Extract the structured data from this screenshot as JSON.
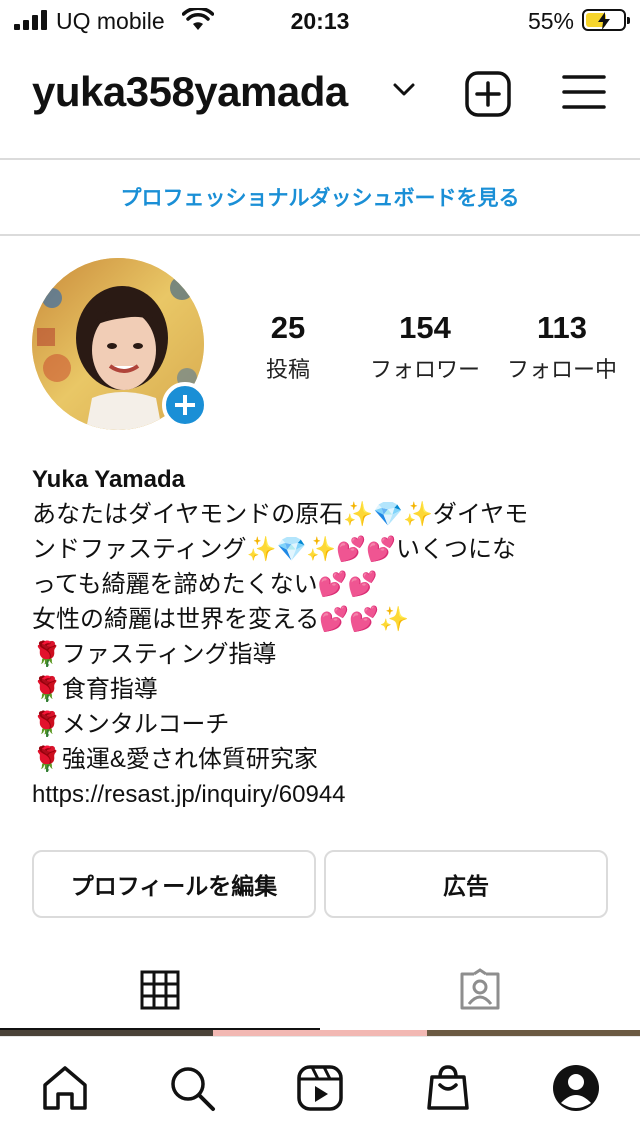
{
  "status_bar": {
    "carrier": "UQ mobile",
    "time": "20:13",
    "battery_percent": "55%",
    "battery_level": 0.55,
    "charging": true
  },
  "header": {
    "username": "yuka358yamada",
    "icons": [
      "chevron-down-icon",
      "new-post-icon",
      "menu-icon"
    ]
  },
  "dashboard": {
    "label": "プロフェッショナルダッシュボードを見る",
    "color": "#1a8fd6"
  },
  "profile": {
    "stats": [
      {
        "value": "25",
        "label": "投稿"
      },
      {
        "value": "154",
        "label": "フォロワー"
      },
      {
        "value": "113",
        "label": "フォロー中"
      }
    ],
    "name": "Yuka Yamada",
    "bio_lines": [
      "あなたはダイヤモンドの原石✨💎✨ダイヤモ",
      "ンドファスティング✨💎✨💕💕いくつにな",
      "っても綺麗を諦めたくない💕💕",
      "女性の綺麗は世界を変える💕💕✨",
      "🌹ファスティング指導",
      "🌹食育指導",
      "🌹メンタルコーチ",
      "🌹強運&愛され体質研究家",
      "https://resast.jp/inquiry/60944"
    ]
  },
  "actions": {
    "edit_profile": "プロフィールを編集",
    "ads": "広告"
  },
  "tabs": {
    "items": [
      "grid-icon",
      "tagged-icon"
    ],
    "active": "grid-icon"
  },
  "bottom_nav": {
    "items": [
      "home-icon",
      "search-icon",
      "reels-icon",
      "shop-icon",
      "profile-icon"
    ]
  }
}
